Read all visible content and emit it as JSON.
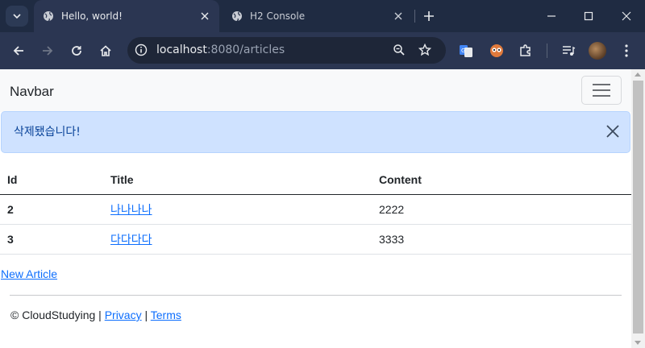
{
  "browser": {
    "tabs": [
      {
        "title": "Hello, world!",
        "active": true
      },
      {
        "title": "H2 Console",
        "active": false
      }
    ],
    "url_host": "localhost",
    "url_rest": ":8080/articles"
  },
  "navbar": {
    "brand": "Navbar"
  },
  "alert": {
    "message": "삭제됐습니다!"
  },
  "table": {
    "headers": {
      "id": "Id",
      "title": "Title",
      "content": "Content"
    },
    "rows": [
      {
        "id": "2",
        "title": "나나나나",
        "content": "2222"
      },
      {
        "id": "3",
        "title": "다다다다",
        "content": "3333"
      }
    ]
  },
  "new_article_link": "New Article",
  "footer": {
    "copyright": "© CloudStudying |",
    "privacy": "Privacy",
    "separator": "|",
    "terms": "Terms"
  },
  "colors": {
    "chrome_dark": "#1f2b42",
    "chrome_toolbar": "#2b3652",
    "alert_bg": "#cfe2ff",
    "alert_text": "#084298",
    "link": "#0d6efd"
  }
}
